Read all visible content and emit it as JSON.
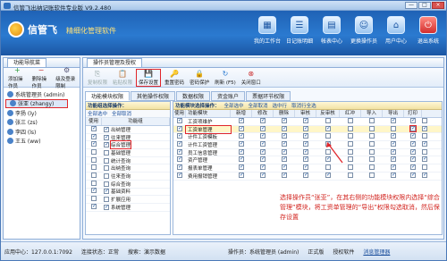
{
  "window": {
    "title": "信管飞出纳记账软件专业版 V9.2.480",
    "btn_min": "—",
    "btn_max": "□",
    "btn_close": "×"
  },
  "banner": {
    "brand": "信管飞",
    "slogan": "精细化管理软件",
    "nav": [
      {
        "label": "我的工作台",
        "icon": "desk-icon",
        "glyph": "▦"
      },
      {
        "label": "日记账明细",
        "icon": "list-icon",
        "glyph": "☰"
      },
      {
        "label": "帐表中心",
        "icon": "report-icon",
        "glyph": "▤"
      },
      {
        "label": "更换操作员",
        "icon": "switch-user-icon",
        "glyph": "☺"
      },
      {
        "label": "用户中心",
        "icon": "user-center-icon",
        "glyph": "⌂"
      },
      {
        "label": "退出系统",
        "icon": "exit-icon",
        "glyph": "⏻"
      }
    ]
  },
  "left": {
    "tab": "功能导航菜",
    "toolbar": [
      {
        "label": "添加操作员",
        "glyph": "+"
      },
      {
        "label": "删除操作员",
        "glyph": "−"
      },
      {
        "label": "级及登录限制",
        "glyph": "⚙"
      }
    ],
    "users": [
      {
        "label": "系统管理员 (admin)"
      },
      {
        "label": "张亚 (zhangy)"
      },
      {
        "label": "李扬 (ly)"
      },
      {
        "label": "张三 (zs)"
      },
      {
        "label": "李四 (ls)"
      },
      {
        "label": "王五 (ww)"
      }
    ]
  },
  "right": {
    "tab": "操作员管理及授权",
    "toolbar": [
      {
        "label": "复制权限",
        "glyph": "⎘"
      },
      {
        "label": "粘贴权限",
        "glyph": "📋"
      },
      {
        "label": "保存设置",
        "glyph": "💾"
      },
      {
        "label": "重置密码",
        "glyph": "🔑"
      },
      {
        "label": "密码保护",
        "glyph": "🔒"
      },
      {
        "label": "刷新 (F5)",
        "glyph": "↻"
      },
      {
        "label": "关闭窗口",
        "glyph": "⊗"
      }
    ],
    "subtabs": [
      "功能模块权限",
      "其他操作权限",
      "数据权限",
      "资金账户",
      "票据环节权限"
    ],
    "p1": {
      "title": "功能组选择操作：",
      "select_all": "全部选中",
      "cancel_all": "全部取消",
      "col_use": "使用",
      "col_group": "功能组",
      "rows": [
        {
          "label": "出纳管理",
          "checked": true
        },
        {
          "label": "往来管理",
          "checked": true
        },
        {
          "label": "综合管理",
          "checked": true
        },
        {
          "label": "基础管理",
          "checked": false
        },
        {
          "label": "统计查询",
          "checked": false
        },
        {
          "label": "出纳查询",
          "checked": false
        },
        {
          "label": "往来查询",
          "checked": false
        },
        {
          "label": "综合查询",
          "checked": false
        },
        {
          "label": "基础资料",
          "checked": true
        },
        {
          "label": "扩展应用",
          "checked": false
        },
        {
          "label": "系统管理",
          "checked": true
        }
      ]
    },
    "p2": {
      "title": "功能模块选择操作：",
      "select_all": "全部选中",
      "cancel_all": "全部取消",
      "select_row": "选中行",
      "cancel_row": "取消行全选",
      "columns": [
        "使用",
        "功能模块",
        "新增",
        "修改",
        "删除",
        "审核",
        "反审核",
        "红冲",
        "导入",
        "导出",
        "打印"
      ],
      "rows": [
        {
          "label": "工资项维护",
          "flags": [
            1,
            1,
            1,
            1,
            0,
            0,
            0,
            1,
            1,
            0
          ]
        },
        {
          "label": "工资单管理",
          "flags": [
            1,
            1,
            1,
            1,
            1,
            0,
            0,
            0,
            1,
            1
          ]
        },
        {
          "label": "计件工资模板",
          "flags": [
            1,
            1,
            1,
            1,
            0,
            0,
            0,
            1,
            1,
            0
          ]
        },
        {
          "label": "计件工资管理",
          "flags": [
            1,
            1,
            1,
            1,
            1,
            0,
            0,
            1,
            1,
            1
          ]
        },
        {
          "label": "员工信息管理",
          "flags": [
            1,
            1,
            1,
            1,
            0,
            0,
            0,
            1,
            1,
            0
          ]
        },
        {
          "label": "资产管理",
          "flags": [
            1,
            1,
            1,
            1,
            1,
            0,
            0,
            1,
            1,
            1
          ]
        },
        {
          "label": "报表单管理",
          "flags": [
            1,
            1,
            1,
            1,
            0,
            0,
            0,
            1,
            1,
            0
          ]
        },
        {
          "label": "费用报销管理",
          "flags": [
            1,
            1,
            1,
            1,
            1,
            0,
            0,
            1,
            1,
            1
          ]
        }
      ]
    },
    "note": "选择操作员“张亚”，在其右侧的功能模块权限内选择“综合管理”模块，将工资单管理的“导出”权限勾选取消，然后保存设置"
  },
  "status": {
    "app_center": "应用中心：127.0.0.1:7092",
    "connection": "连接状态：正常",
    "shortcut": "搜索：演示数据",
    "operator": "操作员：系统管理员 (admin)",
    "edition": "正式版",
    "auth": "授权软件",
    "link": "消息管理器"
  },
  "colors": {
    "accent": "#1f62b5",
    "highlight": "#e0262b",
    "slogan": "#ffe27a"
  }
}
